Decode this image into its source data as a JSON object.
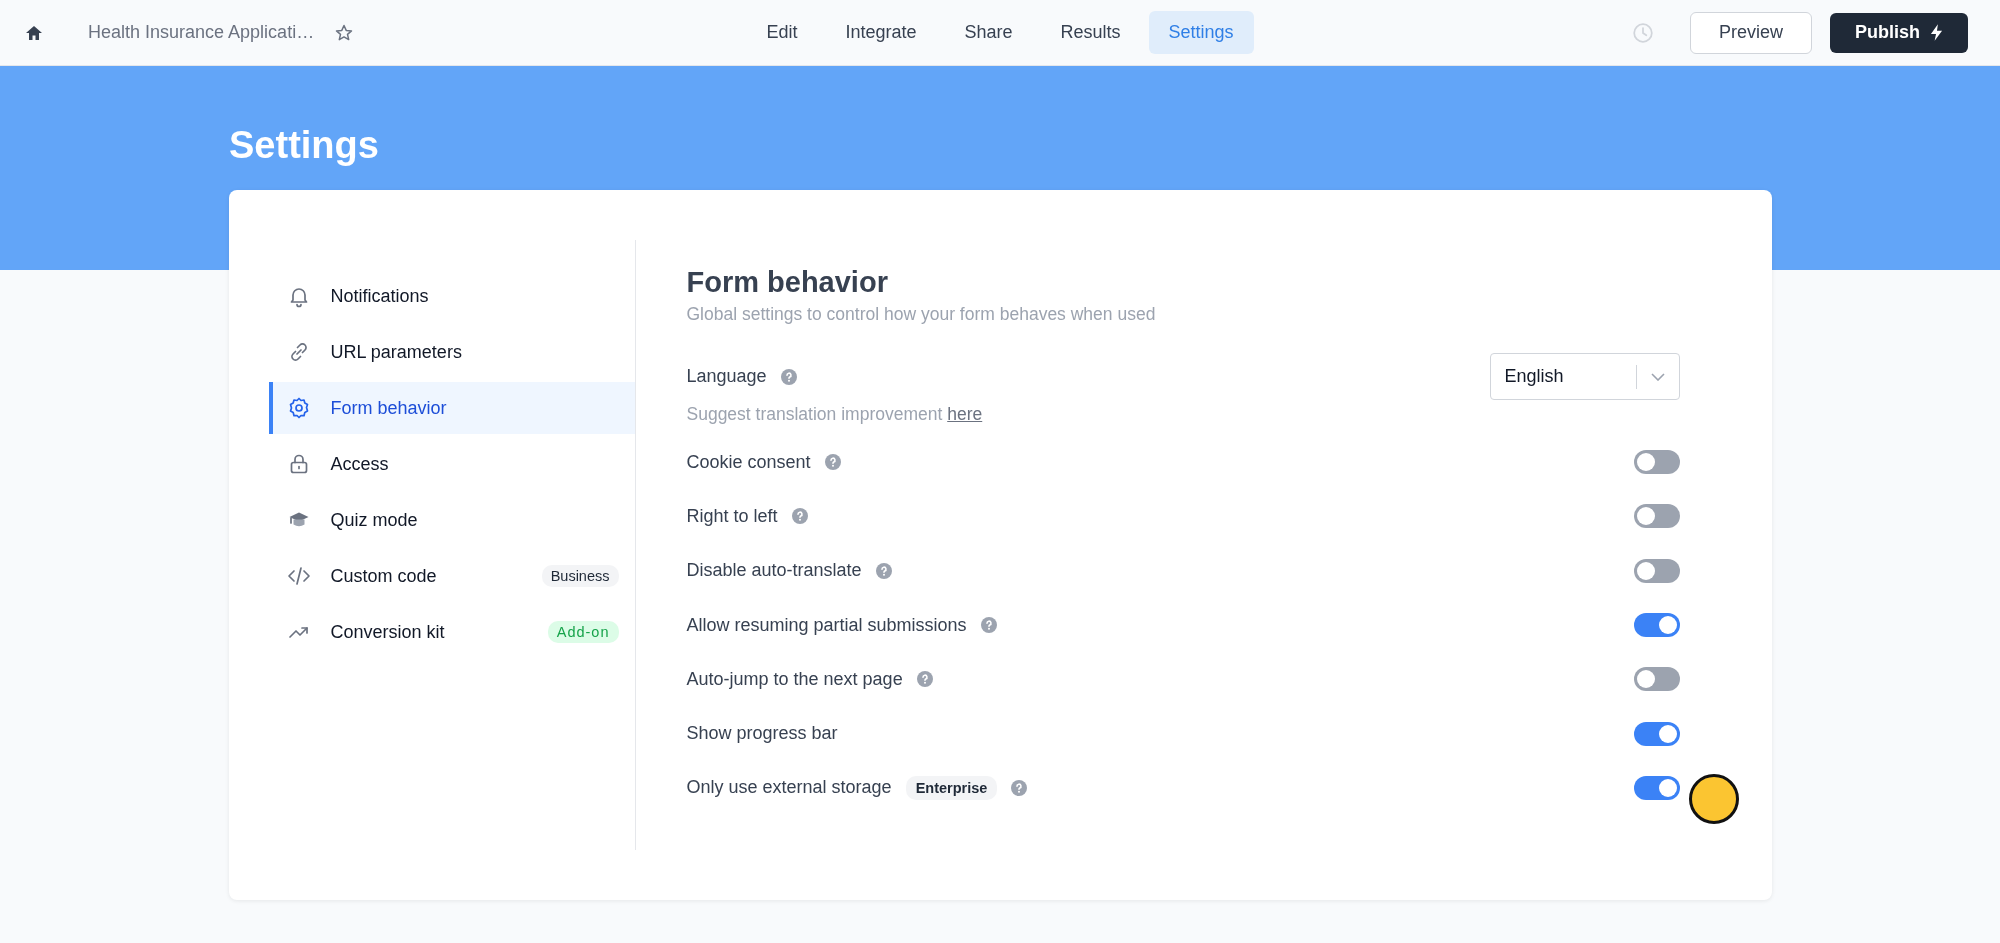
{
  "top_bar": {
    "title": "Health Insurance Applicati…",
    "nav_tabs": [
      {
        "label": "Edit",
        "selected": false
      },
      {
        "label": "Integrate",
        "selected": false
      },
      {
        "label": "Share",
        "selected": false
      },
      {
        "label": "Results",
        "selected": false
      },
      {
        "label": "Settings",
        "selected": true
      }
    ],
    "preview_button": "Preview",
    "publish_button": "Publish"
  },
  "banner": {
    "title": "Settings"
  },
  "sidebar": {
    "items": [
      {
        "label": "Notifications",
        "selected": false
      },
      {
        "label": "URL parameters",
        "selected": false
      },
      {
        "label": "Form behavior",
        "selected": true
      },
      {
        "label": "Access",
        "selected": false
      },
      {
        "label": "Quiz mode",
        "selected": false
      },
      {
        "label": "Custom code",
        "selected": false,
        "badge": {
          "text": "Business",
          "kind": "plan"
        }
      },
      {
        "label": "Conversion kit",
        "selected": false,
        "badge": {
          "text": "Add-on",
          "kind": "addon"
        }
      }
    ]
  },
  "content": {
    "title": "Form behavior",
    "subtitle": "Global settings to control how your form behaves when used",
    "language": {
      "label": "Language",
      "value": "English",
      "hint": "Suggest translation improvement",
      "hint_link": "here"
    },
    "settings": [
      {
        "label": "Cookie consent",
        "help": true,
        "on": false
      },
      {
        "label": "Right to left",
        "help": true,
        "on": false
      },
      {
        "label": "Disable auto-translate",
        "help": true,
        "on": false
      },
      {
        "label": "Allow resuming partial submissions",
        "help": true,
        "on": true
      },
      {
        "label": "Auto-jump to the next page",
        "help": true,
        "on": false
      },
      {
        "label": "Show progress bar",
        "help": false,
        "on": true
      },
      {
        "label": "Only use external storage",
        "help": true,
        "on": true,
        "badge": "Enterprise"
      }
    ]
  }
}
